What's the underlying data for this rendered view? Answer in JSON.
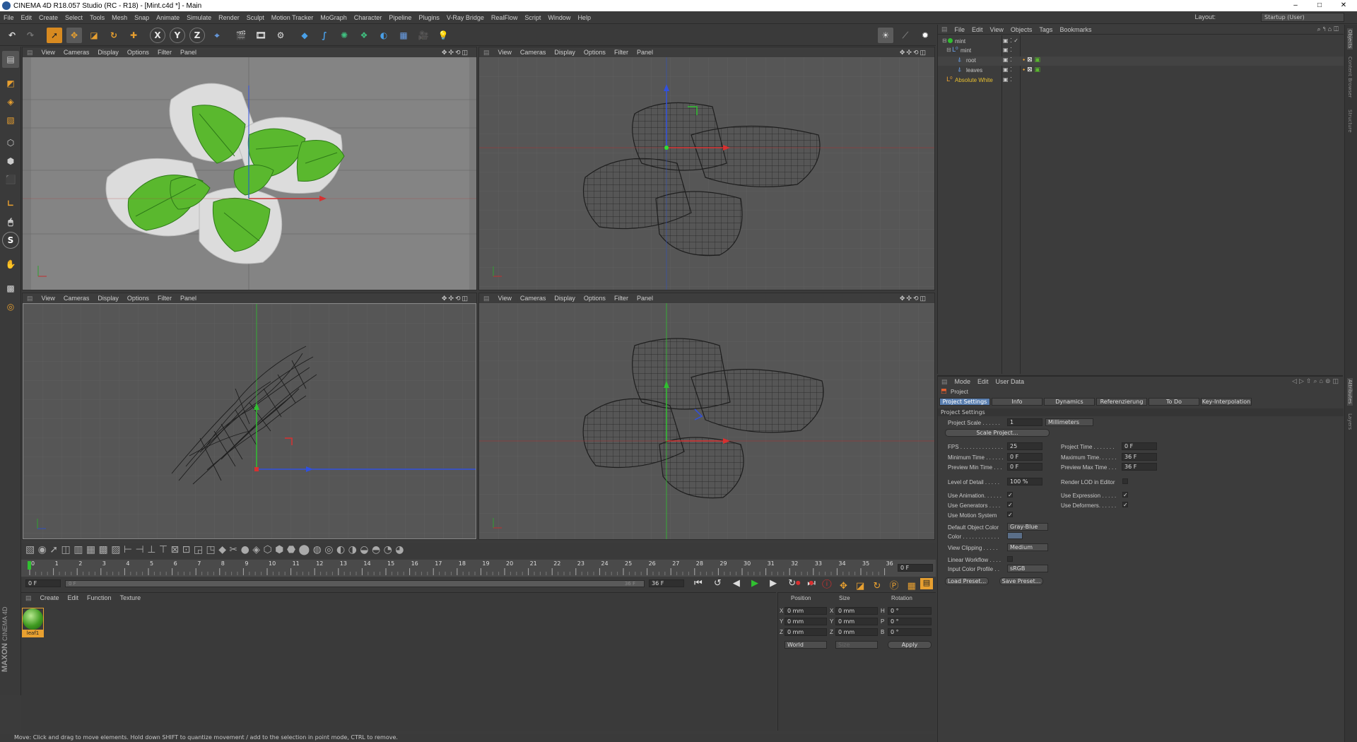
{
  "window": {
    "title": "CINEMA 4D R18.057 Studio (RC - R18) - [Mint.c4d *] - Main",
    "controls": [
      "–",
      "□",
      "✕"
    ]
  },
  "menu": [
    "File",
    "Edit",
    "Create",
    "Select",
    "Tools",
    "Mesh",
    "Snap",
    "Animate",
    "Simulate",
    "Render",
    "Sculpt",
    "Motion Tracker",
    "MoGraph",
    "Character",
    "Pipeline",
    "Plugins",
    "V-Ray Bridge",
    "RealFlow",
    "Script",
    "Window",
    "Help"
  ],
  "layout": {
    "label": "Layout:",
    "value": "Startup (User)"
  },
  "viewport_menu": [
    "View",
    "Cameras",
    "Display",
    "Options",
    "Filter",
    "Panel"
  ],
  "timeline": {
    "ticks": [
      "0",
      "1",
      "2",
      "3",
      "4",
      "5",
      "6",
      "7",
      "8",
      "9",
      "10",
      "11",
      "12",
      "13",
      "14",
      "15",
      "16",
      "17",
      "18",
      "19",
      "20",
      "21",
      "22",
      "23",
      "24",
      "25",
      "26",
      "27",
      "28",
      "29",
      "30",
      "31",
      "32",
      "33",
      "34",
      "35",
      "36"
    ],
    "current": "0 F",
    "start": "0 F",
    "end_field": "36 F",
    "end_range": "36 F",
    "range_start": "0 F"
  },
  "material_manager": {
    "menu": [
      "Create",
      "Edit",
      "Function",
      "Texture"
    ],
    "material_name": "leaf1"
  },
  "coord": {
    "headers": [
      "Position",
      "Size",
      "Rotation"
    ],
    "rows": [
      {
        "a": "X",
        "pos": "0 mm",
        "b": "X",
        "size": "0 mm",
        "c": "H",
        "rot": "0 °"
      },
      {
        "a": "Y",
        "pos": "0 mm",
        "b": "Y",
        "size": "0 mm",
        "c": "P",
        "rot": "0 °"
      },
      {
        "a": "Z",
        "pos": "0 mm",
        "b": "Z",
        "size": "0 mm",
        "c": "B",
        "rot": "0 °"
      }
    ],
    "world": "World",
    "size_mode": "Size",
    "apply": "Apply"
  },
  "status": "Move: Click and drag to move elements. Hold down SHIFT to quantize movement / add to the selection in point mode, CTRL to remove.",
  "object_manager": {
    "menu": [
      "File",
      "Edit",
      "View",
      "Objects",
      "Tags",
      "Bookmarks"
    ],
    "items": [
      {
        "name": "mint",
        "indent": 0
      },
      {
        "name": "mint",
        "indent": 1
      },
      {
        "name": "root",
        "indent": 2
      },
      {
        "name": "leaves",
        "indent": 2
      },
      {
        "name": "Absolute White",
        "indent": 0
      }
    ]
  },
  "attributes": {
    "menu": [
      "Mode",
      "Edit",
      "User Data"
    ],
    "header": "Project",
    "tabs": [
      "Project Settings",
      "Info",
      "Dynamics",
      "Referenzierung",
      "To Do",
      "Key-Interpolation"
    ],
    "section": "Project Settings",
    "project_scale": {
      "label": "Project Scale . . . . . .",
      "value": "1",
      "unit": "Millimeters"
    },
    "scale_button": "Scale Project...",
    "left": [
      {
        "label": "FPS . . . . . . . . . . . . . .",
        "value": "25"
      },
      {
        "label": "Minimum Time . . . . . .",
        "value": "0 F"
      },
      {
        "label": "Preview Min Time . . .",
        "value": "0 F"
      },
      {
        "label": "Level of Detail . . . . .",
        "value": "100 %"
      }
    ],
    "right": [
      {
        "label": "Project Time . . . . . . .",
        "value": "0 F"
      },
      {
        "label": "Maximum Time. . . . . .",
        "value": "36 F"
      },
      {
        "label": "Preview Max Time . . .",
        "value": "36 F"
      }
    ],
    "render_lod": "Render LOD in Editor",
    "checks_left": [
      "Use Animation. . . . . .",
      "Use Generators . . . .",
      "Use Motion System"
    ],
    "checks_right": [
      "Use Expression . . . . .",
      "Use Deformers. . . . . ."
    ],
    "default_color": {
      "label": "Default Object Color",
      "value": "Gray-Blue"
    },
    "color_label": "Color . . . . . . . . . . . .",
    "view_clipping": {
      "label": "View Clipping . . . . .",
      "value": "Medium"
    },
    "linear_workflow": "Linear Workflow . . . .",
    "input_color": {
      "label": "Input Color Profile . .",
      "value": "sRGB"
    },
    "load_preset": "Load Preset...",
    "save_preset": "Save Preset..."
  },
  "side_tabs": [
    "Objects",
    "Content Browser",
    "Structure",
    "Attributes",
    "Layers"
  ],
  "brand": {
    "maxon": "MAXON",
    "c4d": "CINEMA 4D"
  },
  "colors": {
    "accent": "#e89a2a",
    "axis_x": "#d83030",
    "axis_y": "#30c030",
    "axis_z": "#3050e0",
    "leaf": "#4fa82a"
  }
}
